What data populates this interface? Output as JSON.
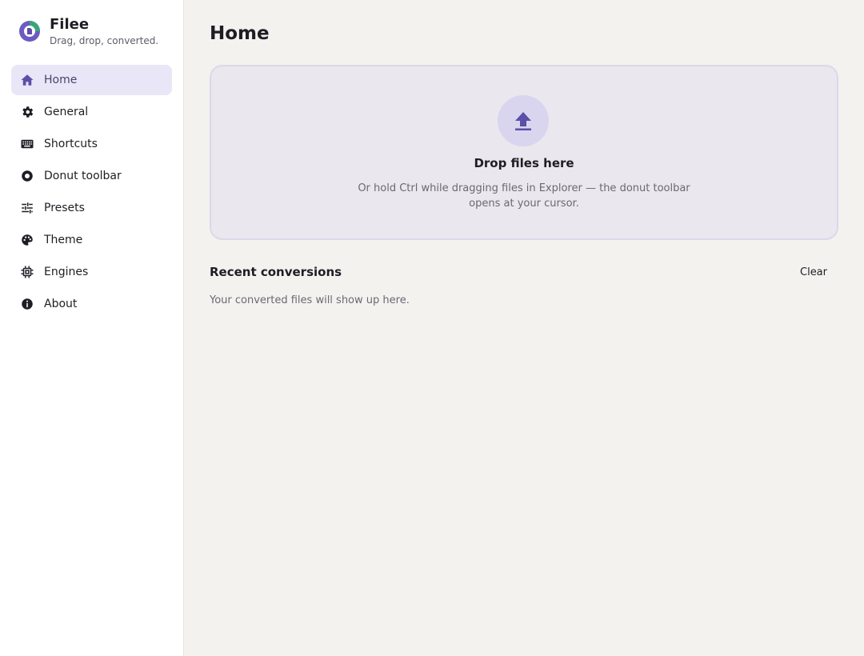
{
  "app": {
    "name": "Filee",
    "tagline": "Drag, drop, converted.",
    "logo_icon": "filee-logo-icon"
  },
  "colors": {
    "accent": "#5b4fa8",
    "nav_active_bg": "#e8e6f7",
    "dropzone_bg": "#eae7ee"
  },
  "sidebar": {
    "items": [
      {
        "label": "Home",
        "icon": "home-icon",
        "active": true
      },
      {
        "label": "General",
        "icon": "gear-icon",
        "active": false
      },
      {
        "label": "Shortcuts",
        "icon": "keyboard-icon",
        "active": false
      },
      {
        "label": "Donut toolbar",
        "icon": "donut-icon",
        "active": false
      },
      {
        "label": "Presets",
        "icon": "sliders-icon",
        "active": false
      },
      {
        "label": "Theme",
        "icon": "palette-icon",
        "active": false
      },
      {
        "label": "Engines",
        "icon": "chip-icon",
        "active": false
      },
      {
        "label": "About",
        "icon": "info-icon",
        "active": false
      }
    ]
  },
  "main": {
    "title": "Home",
    "dropzone": {
      "icon": "upload-icon",
      "title": "Drop files here",
      "description": "Or hold Ctrl while dragging files in Explorer — the donut toolbar opens at your cursor."
    },
    "recent": {
      "title": "Recent conversions",
      "clear_label": "Clear",
      "empty_text": "Your converted files will show up here."
    }
  }
}
